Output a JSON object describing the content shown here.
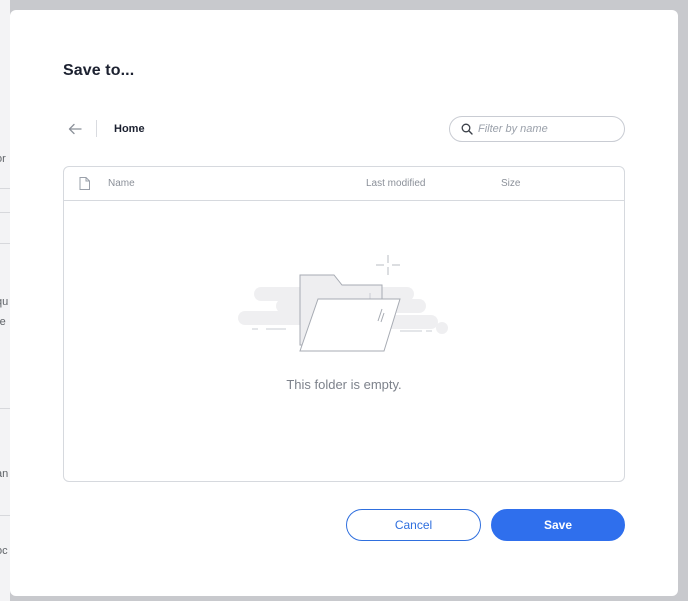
{
  "background": {
    "fragments": [
      "or",
      "qu",
      "re",
      "an",
      "oc"
    ]
  },
  "dialog": {
    "title": "Save to...",
    "back_icon": "arrow-left-icon",
    "breadcrumb": "Home",
    "search": {
      "icon": "search-icon",
      "placeholder": "Filter by name",
      "value": ""
    },
    "table": {
      "header_icon": "file-icon",
      "columns": [
        "Name",
        "Last modified",
        "Size"
      ],
      "rows": [],
      "empty_message": "This folder is empty.",
      "empty_icon": "empty-folder-illustration"
    },
    "buttons": {
      "cancel": "Cancel",
      "save": "Save"
    }
  },
  "colors": {
    "primary": "#2f6fed",
    "title": "#1c2130",
    "muted": "#8b9099",
    "overlay": "#c8c9cd"
  }
}
